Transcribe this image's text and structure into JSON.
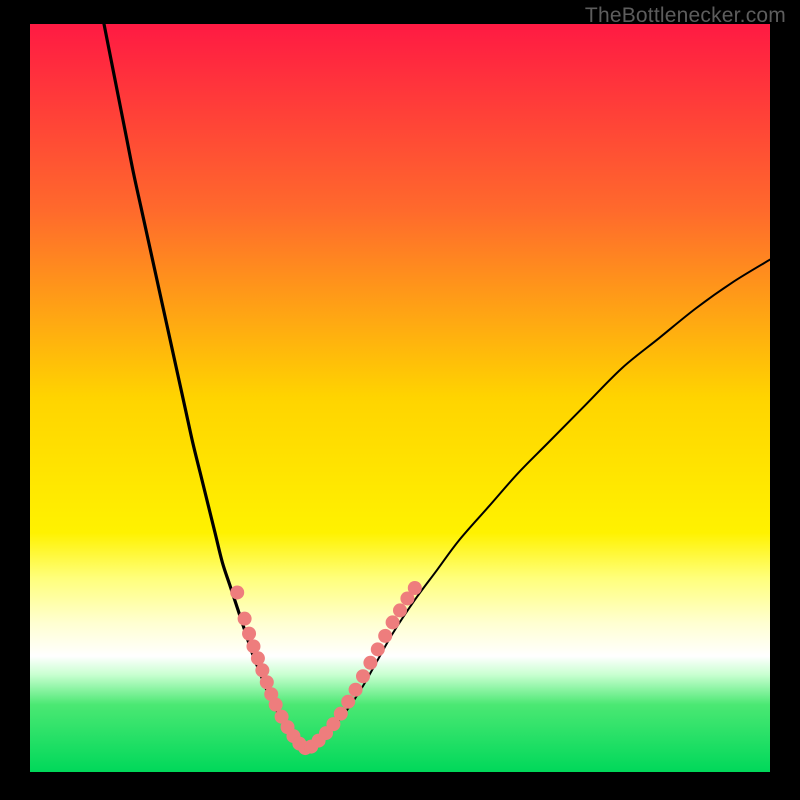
{
  "watermark": "TheBottlenecker.com",
  "chart_data": {
    "type": "line",
    "title": "",
    "xlabel": "",
    "ylabel": "",
    "xlim": [
      0,
      100
    ],
    "ylim": [
      0,
      100
    ],
    "gradient_stops": [
      {
        "offset": 0,
        "color": "#ff1a43"
      },
      {
        "offset": 0.25,
        "color": "#ff6a2c"
      },
      {
        "offset": 0.5,
        "color": "#ffd400"
      },
      {
        "offset": 0.68,
        "color": "#fff200"
      },
      {
        "offset": 0.74,
        "color": "#ffff7a"
      },
      {
        "offset": 0.8,
        "color": "#ffffd0"
      },
      {
        "offset": 0.845,
        "color": "#ffffff"
      },
      {
        "offset": 0.87,
        "color": "#c8ffd0"
      },
      {
        "offset": 0.91,
        "color": "#4be873"
      },
      {
        "offset": 1.0,
        "color": "#00d85a"
      }
    ],
    "series": [
      {
        "name": "left-branch",
        "x": [
          10,
          11,
          12,
          13,
          14,
          15,
          16,
          17,
          18,
          19,
          20,
          21,
          22,
          23,
          24,
          25,
          26,
          27,
          28,
          29,
          30,
          31,
          32,
          33,
          34,
          35,
          36,
          37
        ],
        "y": [
          100,
          95,
          90,
          85,
          80,
          75.5,
          71,
          66.5,
          62,
          57.5,
          53,
          48.5,
          44,
          40,
          36,
          32,
          28,
          25,
          22,
          19,
          16,
          13.5,
          11,
          9,
          7,
          5.5,
          4,
          3
        ]
      },
      {
        "name": "right-branch",
        "x": [
          37,
          39,
          41,
          43,
          45,
          47,
          49,
          52,
          55,
          58,
          62,
          66,
          70,
          75,
          80,
          85,
          90,
          95,
          100
        ],
        "y": [
          3,
          4,
          6,
          8.5,
          11.5,
          15,
          18.5,
          23,
          27,
          31,
          35.5,
          40,
          44,
          49,
          54,
          58,
          62,
          65.5,
          68.5
        ]
      }
    ],
    "dots": [
      {
        "x": 28.0,
        "y": 24.0
      },
      {
        "x": 29.0,
        "y": 20.5
      },
      {
        "x": 29.6,
        "y": 18.5
      },
      {
        "x": 30.2,
        "y": 16.8
      },
      {
        "x": 30.8,
        "y": 15.2
      },
      {
        "x": 31.4,
        "y": 13.6
      },
      {
        "x": 32.0,
        "y": 12.0
      },
      {
        "x": 32.6,
        "y": 10.4
      },
      {
        "x": 33.2,
        "y": 9.0
      },
      {
        "x": 34.0,
        "y": 7.4
      },
      {
        "x": 34.8,
        "y": 6.0
      },
      {
        "x": 35.6,
        "y": 4.8
      },
      {
        "x": 36.4,
        "y": 3.8
      },
      {
        "x": 37.2,
        "y": 3.2
      },
      {
        "x": 38.0,
        "y": 3.4
      },
      {
        "x": 39.0,
        "y": 4.2
      },
      {
        "x": 40.0,
        "y": 5.2
      },
      {
        "x": 41.0,
        "y": 6.4
      },
      {
        "x": 42.0,
        "y": 7.8
      },
      {
        "x": 43.0,
        "y": 9.4
      },
      {
        "x": 44.0,
        "y": 11.0
      },
      {
        "x": 45.0,
        "y": 12.8
      },
      {
        "x": 46.0,
        "y": 14.6
      },
      {
        "x": 47.0,
        "y": 16.4
      },
      {
        "x": 48.0,
        "y": 18.2
      },
      {
        "x": 49.0,
        "y": 20.0
      },
      {
        "x": 50.0,
        "y": 21.6
      },
      {
        "x": 51.0,
        "y": 23.2
      },
      {
        "x": 52.0,
        "y": 24.6
      }
    ],
    "dot_color": "#ee7d7d",
    "dot_radius": 7,
    "curve_stroke": "#000000",
    "curve_width_left": 3.2,
    "curve_width_right": 2.0
  }
}
